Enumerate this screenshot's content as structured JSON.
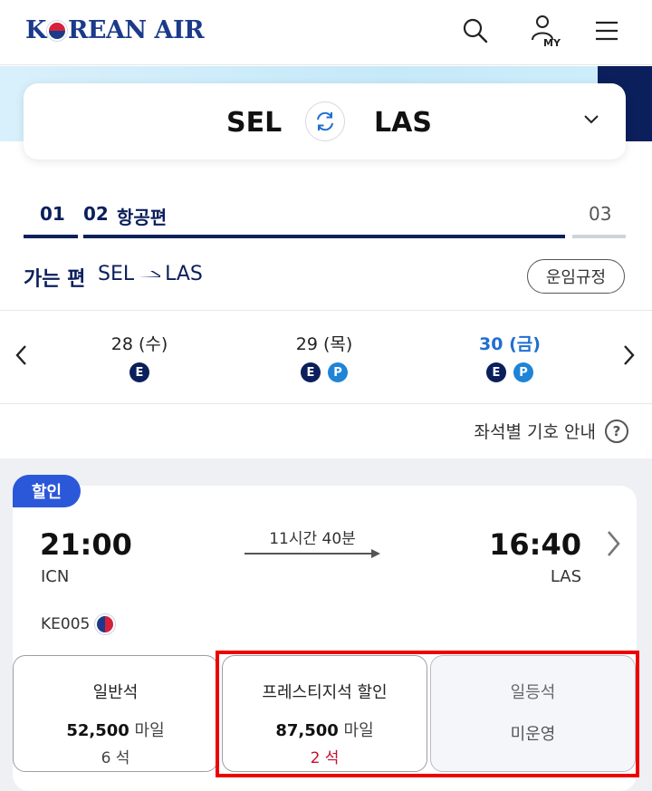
{
  "header": {
    "brand": "KOREAN AIR",
    "brand_pre": "K",
    "brand_post": "REAN AIR",
    "icons": [
      "search-icon",
      "my-account-icon",
      "menu-icon"
    ],
    "my_label": "MY"
  },
  "route": {
    "from": "SEL",
    "to": "LAS"
  },
  "steps": [
    {
      "num": "01",
      "label": ""
    },
    {
      "num": "02",
      "label": "항공편"
    },
    {
      "num": "03",
      "label": ""
    }
  ],
  "direction": {
    "title": "가는 편",
    "from": "SEL",
    "to": "LAS",
    "fare_rules_label": "운임규정"
  },
  "dates": [
    {
      "label": "28 (수)",
      "badges": [
        "E"
      ],
      "active": false
    },
    {
      "label": "29 (목)",
      "badges": [
        "E",
        "P"
      ],
      "active": false
    },
    {
      "label": "30 (금)",
      "badges": [
        "E",
        "P"
      ],
      "active": true
    }
  ],
  "symbol_guide_label": "좌석별 기호 안내",
  "flight": {
    "tag": "할인",
    "departure_time": "21:00",
    "departure_code": "ICN",
    "arrival_time": "16:40",
    "arrival_code": "LAS",
    "duration": "11시간 40분",
    "flight_number": "KE005"
  },
  "fares": [
    {
      "class": "일반석",
      "miles": "52,500",
      "unit": "마일",
      "seats": "6 석",
      "status": ""
    },
    {
      "class": "프레스티지석 할인",
      "miles": "87,500",
      "unit": "마일",
      "seats": "2 석",
      "status": ""
    },
    {
      "class": "일등석",
      "miles": "",
      "unit": "",
      "seats": "",
      "status": "미운영"
    }
  ],
  "colors": {
    "brand_navy": "#0b1f5c",
    "accent_blue": "#1f6fd0",
    "discount_tag": "#2b57d9",
    "low_seats_red": "#c8102e",
    "highlight_red": "#ee0000"
  }
}
